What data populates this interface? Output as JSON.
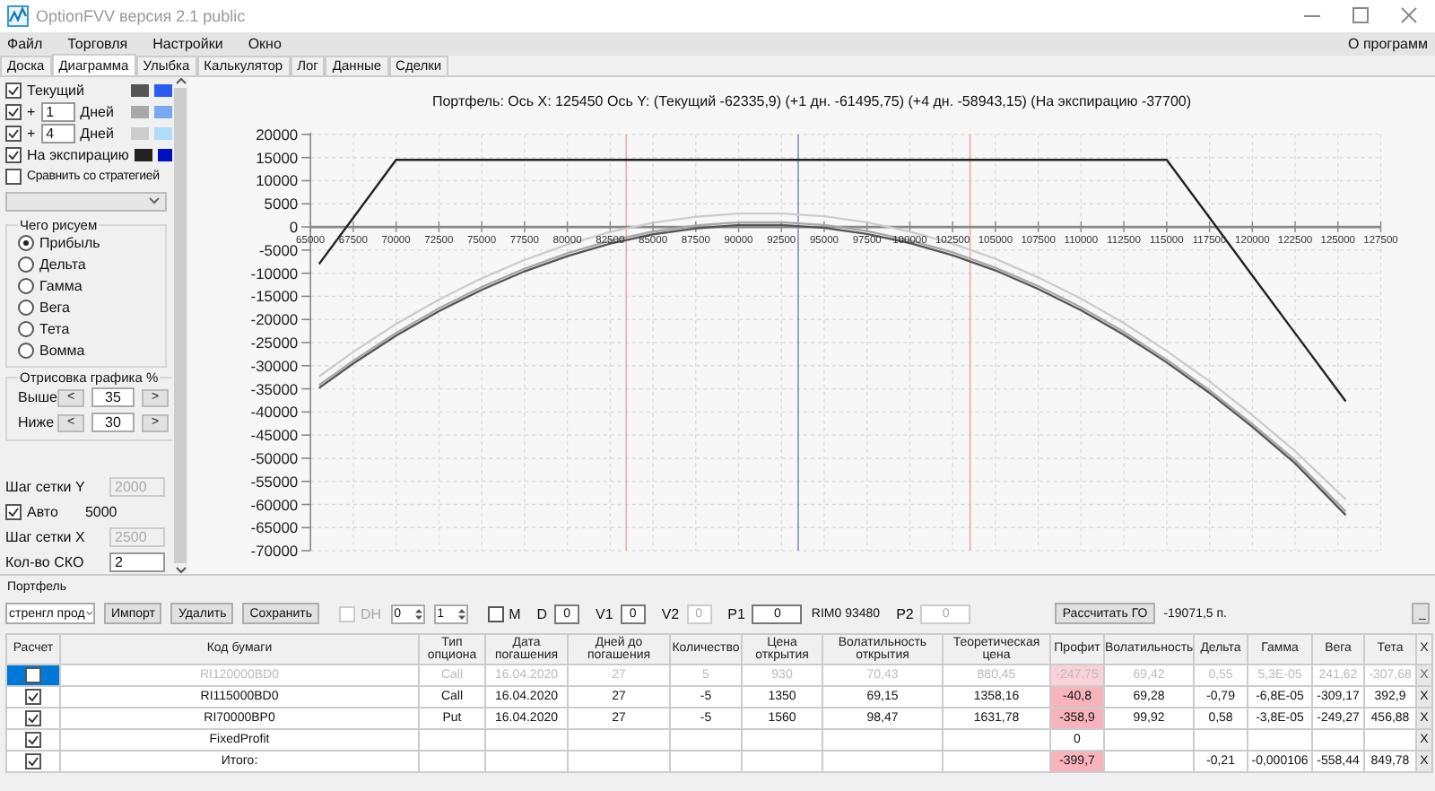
{
  "window": {
    "title": "OptionFVV версия 2.1 public"
  },
  "menu": [
    {
      "label": "Файл"
    },
    {
      "label": "Торговля"
    },
    {
      "label": "Настройки"
    },
    {
      "label": "Окно"
    }
  ],
  "menu_right": {
    "label": "О программ"
  },
  "tabs": [
    {
      "label": "Доска",
      "selected": false
    },
    {
      "label": "Диаграмма",
      "selected": true
    },
    {
      "label": "Улыбка",
      "selected": false
    },
    {
      "label": "Калькулятор",
      "selected": false
    },
    {
      "label": "Лог",
      "selected": false
    },
    {
      "label": "Данные",
      "selected": false
    },
    {
      "label": "Сделки",
      "selected": false
    }
  ],
  "series_settings": [
    {
      "kind": "plain",
      "label": "Текущий",
      "checked": true,
      "swatches": [
        {
          "color": "#555555"
        },
        {
          "color": "#2a5cf0"
        }
      ]
    },
    {
      "kind": "offset",
      "prefix": "+",
      "days": "1",
      "unit": "Дней",
      "checked": true,
      "swatches": [
        {
          "color": "#a8a8a8"
        },
        {
          "color": "#78a8f0"
        }
      ]
    },
    {
      "kind": "offset",
      "prefix": "+",
      "days": "4",
      "unit": "Дней",
      "checked": true,
      "swatches": [
        {
          "color": "#cccccc"
        },
        {
          "color": "#b0dcfa"
        }
      ]
    },
    {
      "kind": "plain",
      "label": "На экспирацию",
      "checked": true,
      "swatches": [
        {
          "color": "#222222"
        },
        {
          "color": "#0010c0"
        }
      ]
    }
  ],
  "compare": {
    "label": "Сравнить со стратегией",
    "checked": false
  },
  "draw_what": {
    "title": "Чего рисуем",
    "options": [
      {
        "label": "Прибыль",
        "selected": true
      },
      {
        "label": "Дельта",
        "selected": false
      },
      {
        "label": "Гамма",
        "selected": false
      },
      {
        "label": "Вега",
        "selected": false
      },
      {
        "label": "Тета",
        "selected": false
      },
      {
        "label": "Вомма",
        "selected": false
      }
    ]
  },
  "range": {
    "title": "Отрисовка графика %",
    "rows": [
      {
        "label": "Выше",
        "dec": "<",
        "value": "35",
        "inc": ">"
      },
      {
        "label": "Ниже",
        "dec": "<",
        "value": "30",
        "inc": ">"
      }
    ]
  },
  "grid": [
    {
      "kind": "field",
      "label": "Шаг сетки Y",
      "value": "2000",
      "disabled": true
    },
    {
      "kind": "check",
      "label": "Авто",
      "checked": true,
      "value": "5000"
    },
    {
      "kind": "field",
      "label": "Шаг сетки X",
      "value": "2500",
      "disabled": true
    },
    {
      "kind": "field",
      "label": "Кол-во СКО",
      "value": "2",
      "disabled": false
    }
  ],
  "chart": {
    "chart_data": {
      "type": "line",
      "title": "Портфель: Ось X: 125450 Ось Y: (Текущий -62335,9) (+1 дн. -61495,75) (+4 дн. -58943,15) (На экспирацию -37700)",
      "x": [
        65500,
        67500,
        70000,
        72500,
        75000,
        77500,
        80000,
        82500,
        85000,
        87500,
        90000,
        92500,
        95000,
        97500,
        100000,
        102500,
        105000,
        107500,
        110000,
        112500,
        115000,
        117500,
        120000,
        122500,
        125450
      ],
      "series": [
        {
          "color": "#555555",
          "values": [
            -34800,
            -29500,
            -23500,
            -18200,
            -13600,
            -9600,
            -6300,
            -3600,
            -1600,
            -300,
            400,
            400,
            -200,
            -1500,
            -3500,
            -6100,
            -9400,
            -13400,
            -18000,
            -23300,
            -29300,
            -35900,
            -43200,
            -51100,
            -62300
          ]
        },
        {
          "color": "#a8a8a8",
          "values": [
            -34200,
            -28900,
            -22900,
            -17600,
            -13000,
            -9000,
            -5700,
            -3000,
            -1000,
            300,
            1000,
            1000,
            400,
            -900,
            -2900,
            -5500,
            -8800,
            -12800,
            -17400,
            -22700,
            -28700,
            -35300,
            -42600,
            -50400,
            -61500
          ]
        },
        {
          "color": "#cccccc",
          "values": [
            -32300,
            -27000,
            -21000,
            -15700,
            -11100,
            -7100,
            -3800,
            -1100,
            900,
            2200,
            2900,
            2900,
            2300,
            1000,
            -1000,
            -3600,
            -6900,
            -10900,
            -15500,
            -20800,
            -26800,
            -33400,
            -40700,
            -48500,
            -58900
          ]
        },
        {
          "color": "#222222",
          "values": [
            -8000,
            2000,
            14500,
            14500,
            14500,
            14500,
            14500,
            14500,
            14500,
            14500,
            14500,
            14500,
            14500,
            14500,
            14500,
            14500,
            14500,
            14500,
            14500,
            14500,
            14500,
            2000,
            -10500,
            -23000,
            -37700
          ]
        }
      ],
      "xlim": [
        65000,
        127500
      ],
      "ylim": [
        -70000,
        20000
      ],
      "xticks": [
        65000,
        67500,
        70000,
        72500,
        75000,
        77500,
        80000,
        82500,
        85000,
        87500,
        90000,
        92500,
        95000,
        97500,
        100000,
        102500,
        105000,
        107500,
        110000,
        112500,
        115000,
        117500,
        120000,
        122500,
        125000,
        127500
      ],
      "yticks": [
        20000,
        15000,
        10000,
        5000,
        0,
        -5000,
        -10000,
        -15000,
        -20000,
        -25000,
        -30000,
        -35000,
        -40000,
        -45000,
        -50000,
        -55000,
        -60000,
        -65000,
        -70000
      ],
      "grid": true,
      "ref_lines": [
        {
          "axis": "x",
          "value": 93480,
          "color": "#8090b0"
        },
        {
          "axis": "x",
          "value": 83440,
          "color": "#f0a8a8"
        },
        {
          "axis": "x",
          "value": 103520,
          "color": "#f0a8a8"
        }
      ]
    }
  },
  "portfolio": {
    "title": "Портфель",
    "toolbar": [
      {
        "kind": "select",
        "value": "стренгл прод"
      },
      {
        "kind": "button",
        "label": "Импорт"
      },
      {
        "kind": "button",
        "label": "Удалить"
      },
      {
        "kind": "button",
        "label": "Сохранить"
      },
      {
        "kind": "check",
        "label": "DH",
        "checked": false,
        "disabled": true
      },
      {
        "kind": "spin",
        "value": "0"
      },
      {
        "kind": "spin",
        "value": "1"
      },
      {
        "kind": "check",
        "label": "M",
        "checked": false,
        "disabled": false
      },
      {
        "kind": "field",
        "label": "D",
        "value": "0",
        "disabled": false
      },
      {
        "kind": "field",
        "label": "V1",
        "value": "0",
        "disabled": false
      },
      {
        "kind": "field",
        "label": "V2",
        "value": "0",
        "disabled": true
      },
      {
        "kind": "field",
        "label": "P1",
        "value": "0",
        "disabled": false
      },
      {
        "kind": "text",
        "text": "RIM0 93480"
      },
      {
        "kind": "field",
        "label": "P2",
        "value": "0",
        "disabled": true
      },
      {
        "kind": "button",
        "label": "Рассчитать ГО"
      },
      {
        "kind": "text",
        "text": "-19071,5 п."
      },
      {
        "kind": "button",
        "label": "_"
      }
    ],
    "columns": [
      {
        "label": "Расчет",
        "kind": "check"
      },
      {
        "label": "Код бумаги",
        "kind": "text"
      },
      {
        "label": "Тип опциона",
        "kind": "text"
      },
      {
        "label": "Дата погашения",
        "kind": "text"
      },
      {
        "label": "Дней до погашения",
        "kind": "text"
      },
      {
        "label": "Количество",
        "kind": "text"
      },
      {
        "label": "Цена открытия",
        "kind": "text"
      },
      {
        "label": "Волатильность открытия",
        "kind": "text"
      },
      {
        "label": "Теоретическая цена",
        "kind": "text"
      },
      {
        "label": "Профит",
        "kind": "profit"
      },
      {
        "label": "Волатильность",
        "kind": "text"
      },
      {
        "label": "Дельта",
        "kind": "text"
      },
      {
        "label": "Гамма",
        "kind": "text"
      },
      {
        "label": "Вега",
        "kind": "text"
      },
      {
        "label": "Тета",
        "kind": "text"
      },
      {
        "label": "X",
        "kind": "delete"
      }
    ],
    "rows": [
      {
        "checked": false,
        "selected": true,
        "disabled": true,
        "loss": true,
        "cells": [
          null,
          "RI120000BD0",
          "Call",
          "16.04.2020",
          "27",
          "5",
          "930",
          "70,43",
          "880,45",
          "-247,75",
          "69,42",
          "0,55",
          "5,3E-05",
          "241,62",
          "-307,68",
          "X"
        ]
      },
      {
        "checked": true,
        "selected": false,
        "disabled": false,
        "loss": true,
        "cells": [
          null,
          "RI115000BD0",
          "Call",
          "16.04.2020",
          "27",
          "-5",
          "1350",
          "69,15",
          "1358,16",
          "-40,8",
          "69,28",
          "-0,79",
          "-6,8E-05",
          "-309,17",
          "392,9",
          "X"
        ]
      },
      {
        "checked": true,
        "selected": false,
        "disabled": false,
        "loss": true,
        "cells": [
          null,
          "RI70000BP0",
          "Put",
          "16.04.2020",
          "27",
          "-5",
          "1560",
          "98,47",
          "1631,78",
          "-358,9",
          "99,92",
          "0,58",
          "-3,8E-05",
          "-249,27",
          "456,88",
          "X"
        ]
      },
      {
        "checked": true,
        "selected": false,
        "disabled": false,
        "loss": false,
        "cells": [
          null,
          "FixedProfit",
          null,
          null,
          null,
          null,
          null,
          null,
          null,
          "0",
          null,
          null,
          null,
          null,
          null,
          "X"
        ]
      },
      {
        "checked": true,
        "selected": false,
        "disabled": false,
        "loss": true,
        "cells": [
          null,
          "Итого:",
          null,
          null,
          null,
          null,
          null,
          null,
          null,
          "-399,7",
          null,
          "-0,21",
          "-0,000106",
          "-558,44",
          "849,78",
          "X"
        ]
      }
    ]
  }
}
